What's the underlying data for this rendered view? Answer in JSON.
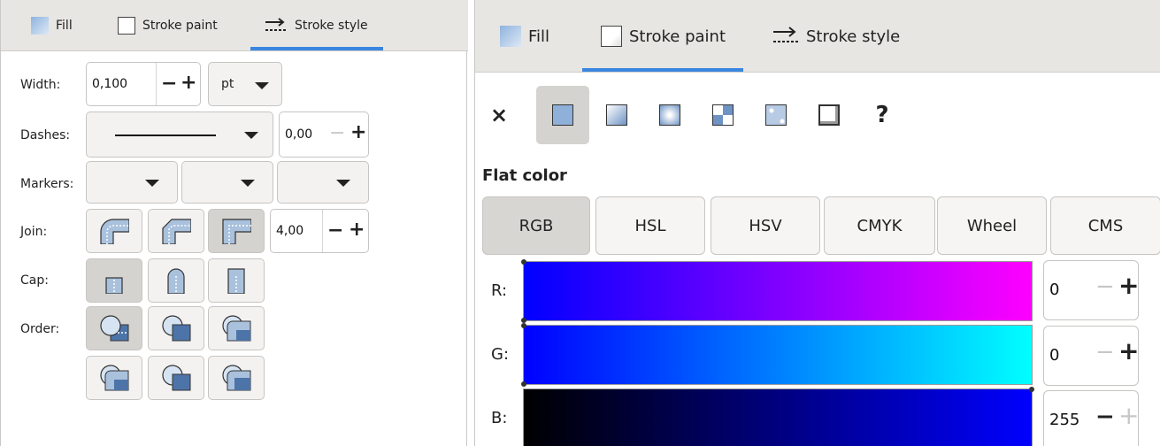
{
  "left_panel": {
    "tabs": [
      {
        "label": "Fill"
      },
      {
        "label": "Stroke paint"
      },
      {
        "label": "Stroke style"
      }
    ],
    "active_tab": "Stroke style",
    "width": {
      "label": "Width:",
      "value": "0,100",
      "unit": "pt",
      "minus": "−",
      "plus": "+"
    },
    "dashes": {
      "label": "Dashes:",
      "offset": "0,00",
      "minus": "−",
      "plus": "+"
    },
    "markers": {
      "label": "Markers:"
    },
    "join": {
      "label": "Join:",
      "miter_limit": "4,00",
      "minus": "−",
      "plus": "+"
    },
    "cap": {
      "label": "Cap:"
    },
    "order": {
      "label": "Order:"
    }
  },
  "right_panel": {
    "tabs": [
      {
        "label": "Fill"
      },
      {
        "label": "Stroke paint"
      },
      {
        "label": "Stroke style"
      }
    ],
    "active_tab": "Stroke paint",
    "paint_types": [
      "no-paint",
      "flat-color",
      "linear-gradient",
      "radial-gradient",
      "pattern",
      "swatch",
      "unset"
    ],
    "no_paint_glyph": "×",
    "unset_glyph": "?",
    "flat_color_label": "Flat color",
    "modes": [
      {
        "label": "RGB"
      },
      {
        "label": "HSL"
      },
      {
        "label": "HSV"
      },
      {
        "label": "CMYK"
      },
      {
        "label": "Wheel"
      },
      {
        "label": "CMS"
      }
    ],
    "active_mode": "RGB",
    "channels": [
      {
        "label": "R:",
        "value": "0",
        "minus": "−",
        "plus": "+"
      },
      {
        "label": "G:",
        "value": "0",
        "minus": "−",
        "plus": "+"
      },
      {
        "label": "B:",
        "value": "255",
        "minus": "−",
        "plus": "+"
      }
    ]
  },
  "colors": {
    "accent": "#3a86e0",
    "r_gradient": [
      "#0000ff",
      "#ff00ff"
    ],
    "g_gradient": [
      "#0000ff",
      "#00ffff"
    ],
    "b_gradient": [
      "#000000",
      "#0000ff"
    ]
  }
}
